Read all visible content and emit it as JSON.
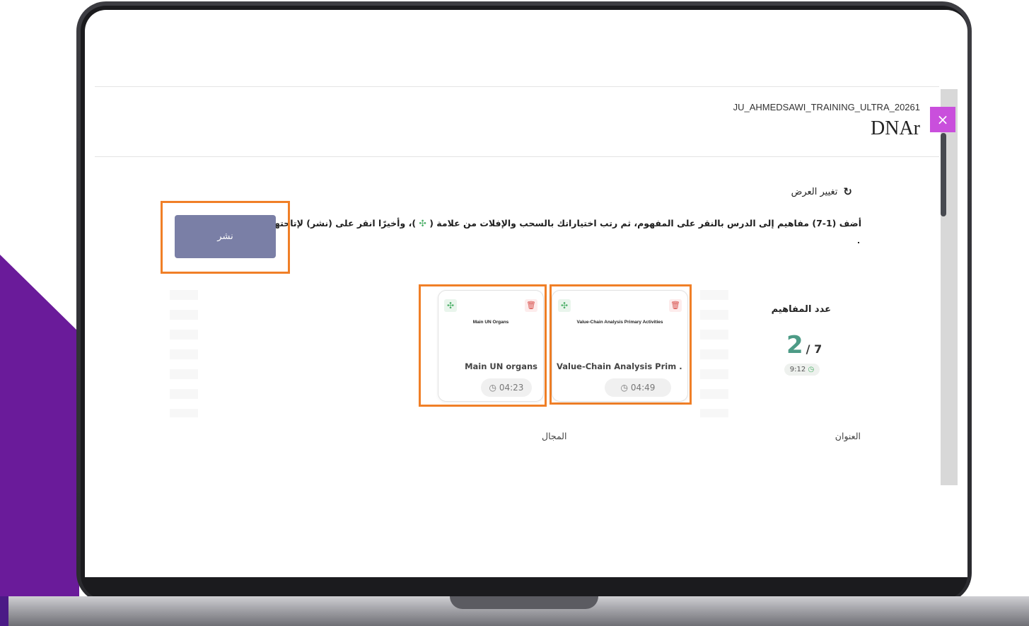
{
  "header": {
    "course_id": "JU_AHMEDSAWI_TRAINING_ULTRA_20261",
    "course_title": "DNAr",
    "close_symbol": "×"
  },
  "toolbar": {
    "change_view_label": "تغيير العرض",
    "change_view_icon": "rotate-icon"
  },
  "instructions": {
    "part1": "أضف (1-7) مفاهيم إلى الدرس بالنقر على المفهوم، ثم رتب اختياراتك بالسحب والإفلات من علامة (",
    "move_glyph": "✣",
    "part2": ")، وأخيرًا انقر على (نشر) لإتاحتها للطلاب"
  },
  "publish": {
    "label": "نشر"
  },
  "concepts": {
    "label": "عدد المفاهيم",
    "count": "2",
    "total": "/ 7",
    "time": "9:12"
  },
  "cards": [
    {
      "thumb_text": "Value-Chain Analysis Primary Activities",
      "title": "Value-Chain Analysis Prim ...",
      "duration": "04:49"
    },
    {
      "thumb_text": "Main UN Organs",
      "title": "Main UN organs",
      "duration": "04:23"
    }
  ],
  "columns": {
    "title_label": "العنوان",
    "field_label": "المجال"
  },
  "colors": {
    "accent_purple": "#c94fdc",
    "highlight_orange": "#f07f27",
    "publish_button": "#7a7fa6",
    "count_green": "#4d9b86",
    "brand_purple": "#6a1b9a"
  }
}
